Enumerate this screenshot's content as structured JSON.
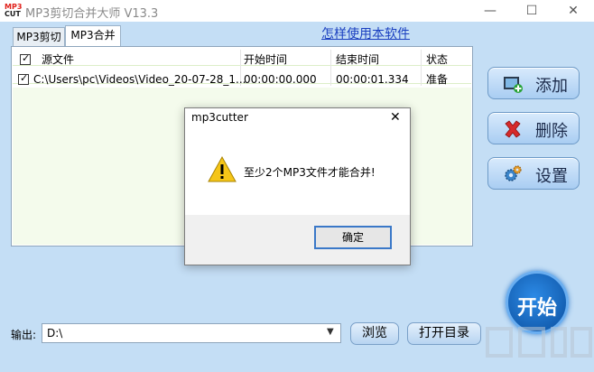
{
  "window": {
    "title": "MP3剪切合并大师 V13.3",
    "logo_top": "MP3",
    "logo_bottom": "CUT",
    "min": "—",
    "max": "☐",
    "close": "✕"
  },
  "tabs": [
    {
      "label": "MP3剪切"
    },
    {
      "label": "MP3合并"
    }
  ],
  "help_link": "怎样使用本软件",
  "table": {
    "headers": [
      "源文件",
      "开始时间",
      "结束时间",
      "状态"
    ],
    "rows": [
      {
        "file": "C:\\Users\\pc\\Videos\\Video_20-07-28_1...",
        "start": "00:00:00.000",
        "end": "00:00:01.334",
        "status": "准备"
      }
    ]
  },
  "side_buttons": {
    "add": "添加",
    "delete": "删除",
    "settings": "设置"
  },
  "start_label": "开始",
  "output": {
    "label": "输出:",
    "value": "D:\\"
  },
  "browse_label": "浏览",
  "open_dir_label": "打开目录",
  "dialog": {
    "title": "mp3cutter",
    "message": "至少2个MP3文件才能合并!",
    "ok": "确定"
  },
  "colors": {
    "accent": "#3a78c8",
    "panel_bg": "#c4def5"
  }
}
